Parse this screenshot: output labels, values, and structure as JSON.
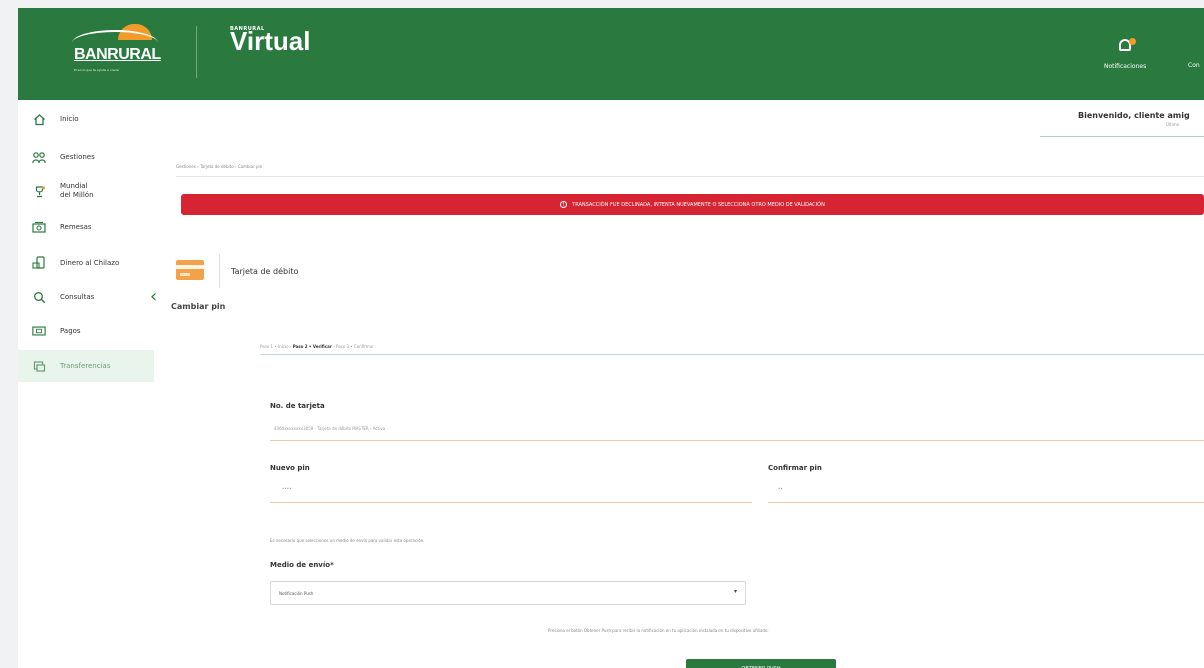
{
  "header": {
    "brand_name": "BANRURAL",
    "brand_tagline": "El socio que te ayuda a crecer",
    "product_small": "BANRURAL",
    "product_name": "Virtual",
    "notifications_label": "Notificaciones",
    "config_label": "Con"
  },
  "sidebar": {
    "items": [
      {
        "label": "Inicio",
        "icon": "home-icon"
      },
      {
        "label": "Gestiones",
        "icon": "people-icon"
      },
      {
        "label": "Mundial\ndel Millón",
        "icon": "trophy-icon"
      },
      {
        "label": "Remesas",
        "icon": "money-icon"
      },
      {
        "label": "Dinero al Chilazo",
        "icon": "phone-money-icon"
      },
      {
        "label": "Consultas",
        "icon": "search-icon"
      },
      {
        "label": "Pagos",
        "icon": "bill-icon"
      },
      {
        "label": "Transferencias",
        "icon": "transfer-icon"
      }
    ],
    "active_index": 7,
    "collapse_label": "‹"
  },
  "welcome": {
    "text": "Bienvenido, cliente amig",
    "sub": "Último"
  },
  "breadcrumb": "Gestiones › Tarjeta de débito › Cambiar pin",
  "alert": {
    "icon": "!",
    "text": "TRANSACCIÓN FUE DECLINADA, INTENTA NUEVAMENTE O SELECCIONA OTRO MEDIO DE VALIDACIÓN",
    "color": "#d62433"
  },
  "card": {
    "title": "Tarjeta de débito"
  },
  "section_title": "Cambiar pin",
  "steps": {
    "step1": "Paso 1 • Inicio",
    "sep1": "›",
    "step2": "Paso 2 • Verificar",
    "sep2": "›",
    "step3": "Paso 3 • Confirmar"
  },
  "form": {
    "card_number_label": "No. de tarjeta",
    "card_number_value": "4364xxxxxxxx3059 - Tarjeta de débito MASTER - Activa",
    "new_pin_label": "Nuevo pin",
    "new_pin_value": "••••",
    "confirm_pin_label": "Confirmar pin",
    "confirm_pin_value": "••",
    "hint": "Es necesario que selecciones un medio de envío para validar esta operación.",
    "send_method_label": "Medio de envío*",
    "send_method_value": "Notificación Push",
    "instructions": "Presiona el botón Obtener Push para recibir la notificación en tu aplicación instalada en tu dispositivo afiliado.",
    "button_label": "OBTENER PUSH"
  },
  "colors": {
    "brand_green": "#2a7a3f",
    "accent_orange": "#f39a2b",
    "danger": "#d62433"
  }
}
